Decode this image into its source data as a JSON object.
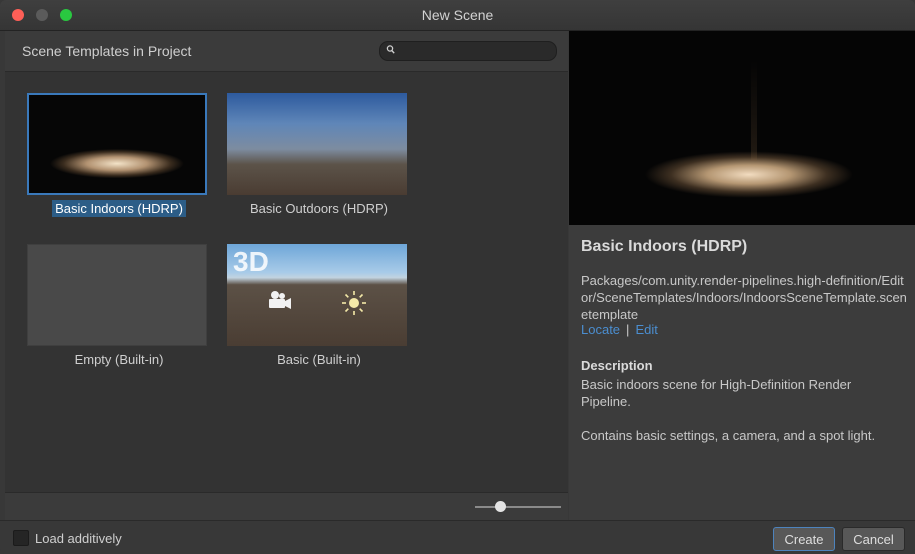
{
  "window": {
    "title": "New Scene"
  },
  "left": {
    "header_title": "Scene Templates in Project",
    "search": {
      "value": "",
      "placeholder": ""
    }
  },
  "templates": [
    {
      "label": "Basic Indoors (HDRP)",
      "selected": true
    },
    {
      "label": "Basic Outdoors (HDRP)",
      "selected": false
    },
    {
      "label": "Empty (Built-in)",
      "selected": false
    },
    {
      "label": "Basic (Built-in)",
      "selected": false,
      "badge": "3D"
    }
  ],
  "details": {
    "title": "Basic Indoors (HDRP)",
    "path": "Packages/com.unity.render-pipelines.high-definition/Editor/SceneTemplates/Indoors/IndoorsSceneTemplate.scenetemplate",
    "locate_label": "Locate",
    "edit_label": "Edit",
    "description_heading": "Description",
    "description_p1": "Basic indoors scene for High-Definition Render Pipeline.",
    "description_p2": "Contains basic settings, a camera, and a spot light."
  },
  "bottom": {
    "load_additively_label": "Load additively",
    "load_additively_checked": false,
    "create_label": "Create",
    "cancel_label": "Cancel"
  },
  "zoom_slider": {
    "value": 0.3
  },
  "colors": {
    "accent": "#3a79bb",
    "link": "#4b8ed0",
    "selection": "#2c5d87"
  }
}
